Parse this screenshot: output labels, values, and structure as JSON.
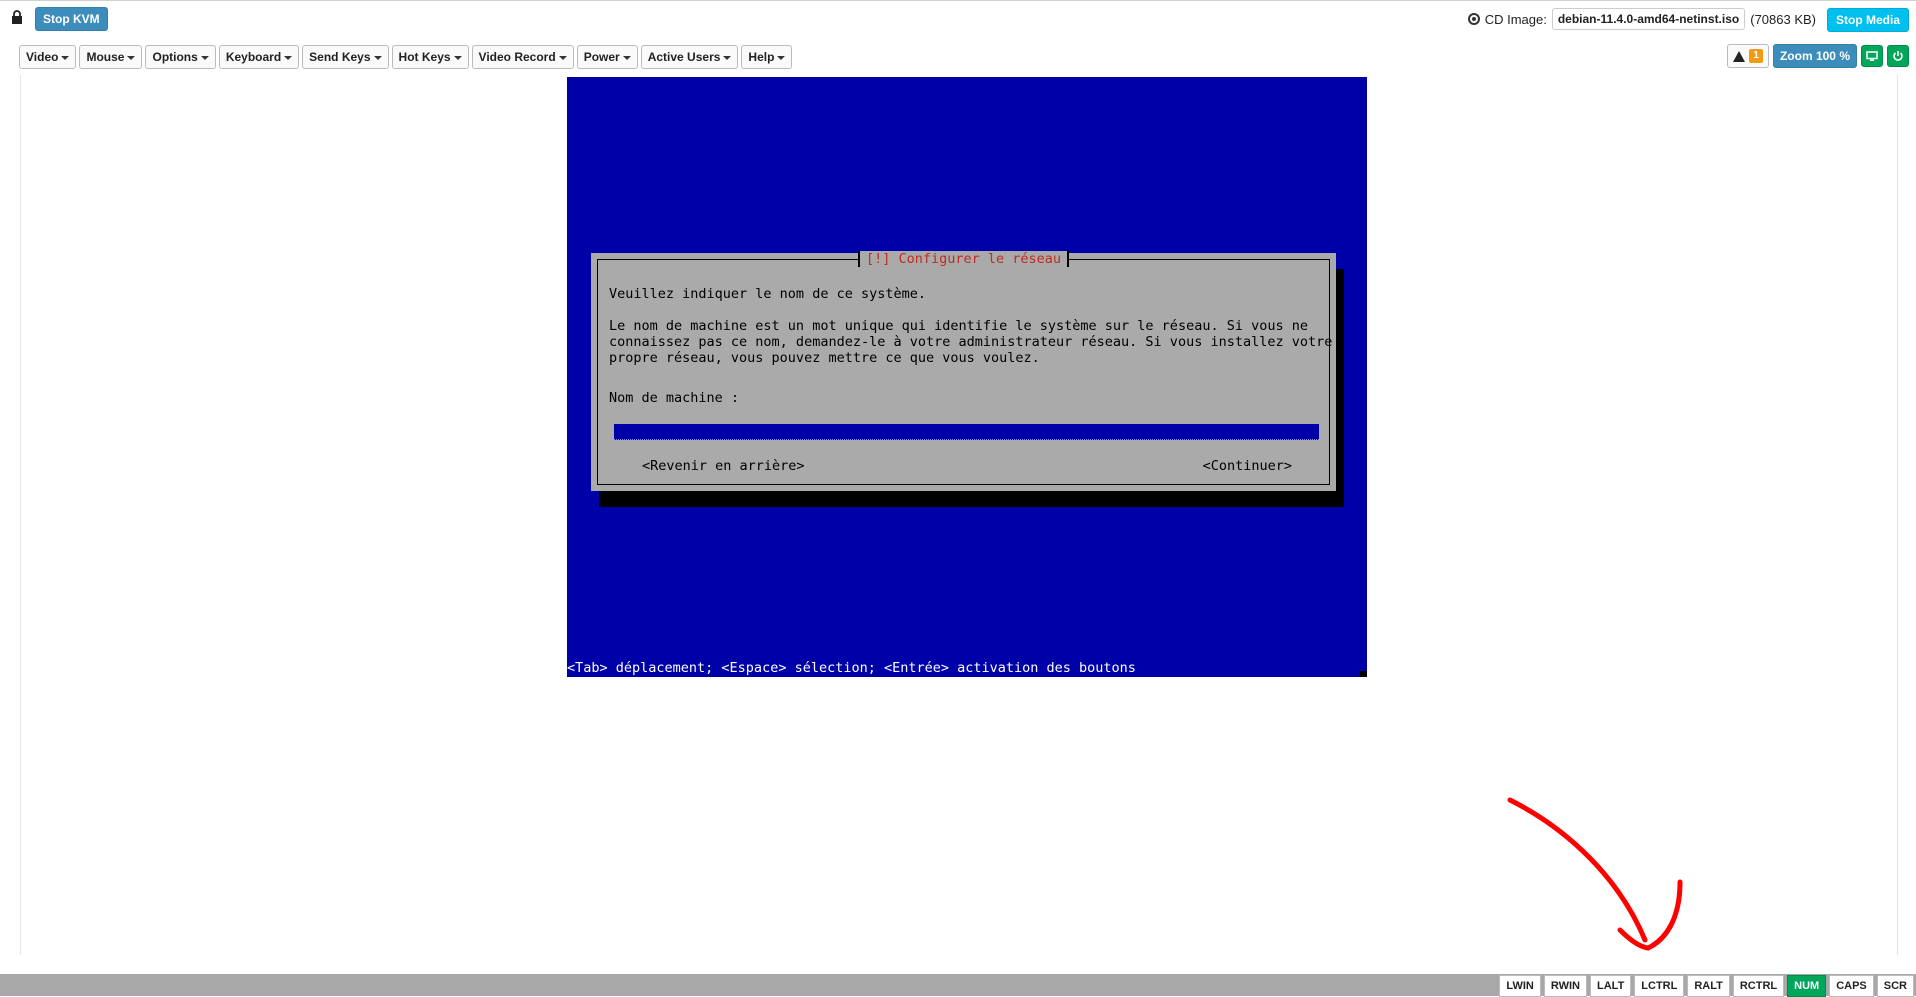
{
  "header": {
    "stop_kvm_label": "Stop KVM",
    "cd_image_label": "CD Image:",
    "cd_image_name": "debian-11.4.0-amd64-netinst.iso",
    "cd_image_size": "(70863 KB)",
    "stop_media_label": "Stop Media"
  },
  "menu": {
    "items": [
      "Video",
      "Mouse",
      "Options",
      "Keyboard",
      "Send Keys",
      "Hot Keys",
      "Video Record",
      "Power",
      "Active Users",
      "Help"
    ]
  },
  "tools": {
    "warning_count": "1",
    "zoom_label": "Zoom 100 %"
  },
  "console": {
    "dialog_title": "[!] Configurer le réseau",
    "line1": "Veuillez indiquer le nom de ce système.",
    "para": "Le nom de machine est un mot unique qui identifie le système sur le réseau. Si vous ne\nconnaissez pas ce nom, demandez-le à votre administrateur réseau. Si vous installez votre\npropre réseau, vous pouvez mettre ce que vous voulez.",
    "field_label": "Nom de machine :",
    "field_value": "",
    "back_button": "<Revenir en arrière>",
    "continue_button": "<Continuer>",
    "status_line": "<Tab> déplacement; <Espace> sélection; <Entrée> activation des boutons"
  },
  "keys": [
    "LWIN",
    "RWIN",
    "LALT",
    "LCTRL",
    "RALT",
    "RCTRL",
    "NUM",
    "CAPS",
    "SCR"
  ],
  "active_key": "NUM",
  "colors": {
    "primary": "#3c8dbc",
    "info": "#00c0ef",
    "success": "#00a65a",
    "console_bg": "#0000a8",
    "dialog_bg": "#aaaaaa",
    "dialog_title": "#c02b1f",
    "annotation": "#ff0000"
  }
}
